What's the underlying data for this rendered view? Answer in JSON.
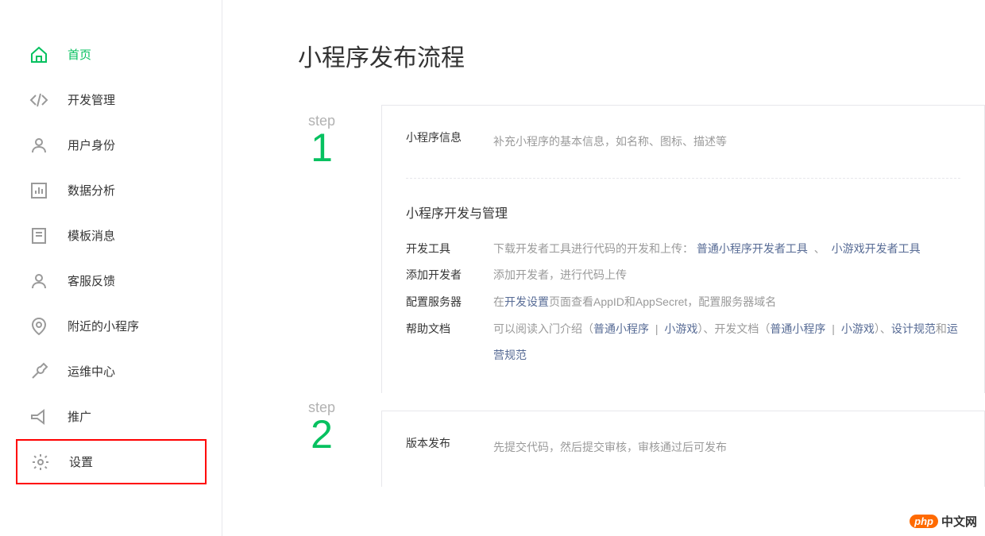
{
  "sidebar": {
    "items": [
      {
        "label": "首页"
      },
      {
        "label": "开发管理"
      },
      {
        "label": "用户身份"
      },
      {
        "label": "数据分析"
      },
      {
        "label": "模板消息"
      },
      {
        "label": "客服反馈"
      },
      {
        "label": "附近的小程序"
      },
      {
        "label": "运维中心"
      },
      {
        "label": "推广"
      },
      {
        "label": "设置"
      }
    ]
  },
  "page": {
    "title": "小程序发布流程"
  },
  "step1": {
    "word": "step",
    "num": "1",
    "info_title": "小程序信息",
    "info_desc": "补充小程序的基本信息，如名称、图标、描述等",
    "dev_title": "小程序开发与管理",
    "rows": {
      "tool_label": "开发工具",
      "tool_text": "下载开发者工具进行代码的开发和上传：",
      "tool_link1": "普通小程序开发者工具",
      "tool_sep": " 、 ",
      "tool_link2": "小游戏开发者工具",
      "dev_label": "添加开发者",
      "dev_text": "添加开发者，进行代码上传",
      "srv_label": "配置服务器",
      "srv_t1": "在",
      "srv_link": "开发设置",
      "srv_t2": "页面查看AppID和AppSecret，配置服务器域名",
      "doc_label": "帮助文档",
      "doc_t1": "可以阅读入门介绍（",
      "doc_l1": "普通小程序",
      "doc_pipe": " | ",
      "doc_l2": "小游戏",
      "doc_t2": "）、开发文档（",
      "doc_l3": "普通小程序",
      "doc_l4": "小游戏",
      "doc_t3": "）、",
      "doc_l5": "设计规范",
      "doc_t4": "和",
      "doc_l6": "运营规范"
    }
  },
  "step2": {
    "word": "step",
    "num": "2",
    "title": "版本发布",
    "desc": "先提交代码，然后提交审核，审核通过后可发布"
  },
  "watermark": {
    "badge": "php",
    "text": "中文网"
  }
}
